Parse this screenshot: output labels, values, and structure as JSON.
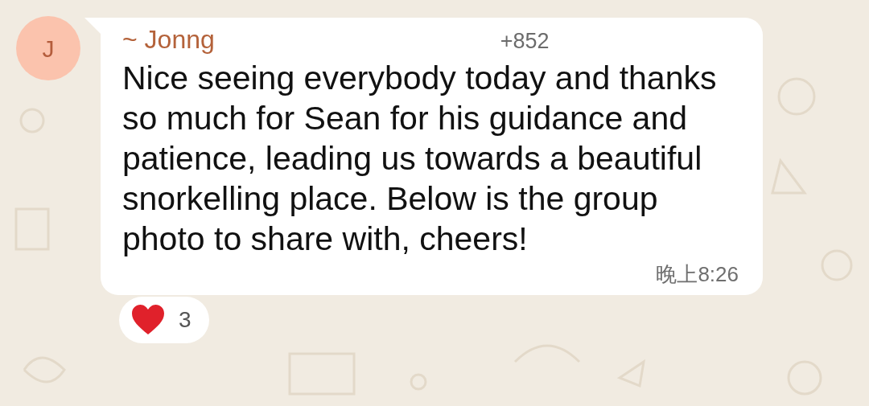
{
  "avatar": {
    "initial": "J"
  },
  "message": {
    "sender": "~ Jonng",
    "phone": "+852",
    "text": "Nice seeing everybody today and thanks so much for Sean for his guidance and patience, leading us towards a beautiful snorkelling place. Below is the group photo to share with, cheers!",
    "time": "晚上8:26"
  },
  "reaction": {
    "count": "3"
  }
}
